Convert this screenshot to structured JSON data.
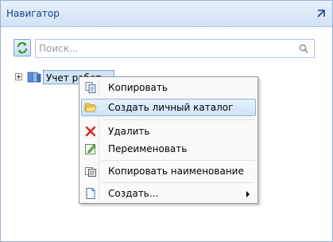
{
  "panel": {
    "title": "Навигатор"
  },
  "search": {
    "placeholder": "Поиск..."
  },
  "tree": {
    "node_label": "Учет работ"
  },
  "context_menu": {
    "items": [
      {
        "label": "Копировать",
        "icon": "copy-icon"
      },
      {
        "label": "Создать личный каталог",
        "icon": "folder-open-icon",
        "highlighted": true
      },
      {
        "label": "Удалить",
        "icon": "delete-x-icon"
      },
      {
        "label": "Переименовать",
        "icon": "rename-icon"
      },
      {
        "label": "Копировать наименование",
        "icon": "copy-name-icon"
      },
      {
        "label": "Создать...",
        "icon": "new-document-icon",
        "has_submenu": true
      }
    ]
  },
  "colors": {
    "header_text": "#15428b",
    "highlight": "#cde2f8",
    "delete_red": "#d9261c"
  }
}
